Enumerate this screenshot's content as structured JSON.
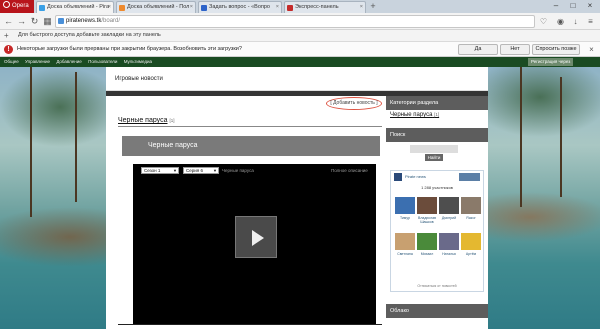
{
  "browser": {
    "menu_label": "Opera",
    "tabs": [
      {
        "title": "Доска объявлений - Pira",
        "color": "#3aa0e6",
        "active": true
      },
      {
        "title": "Доска объявлений - Пол",
        "color": "#ee8a2e",
        "active": false
      },
      {
        "title": "Задать вопрос - «Вопро",
        "color": "#2d63c9",
        "active": false
      },
      {
        "title": "Экспресс-панель",
        "color": "#c42b2b",
        "active": false
      }
    ],
    "url_host": "piratenews.tk",
    "url_path": "/board/",
    "bookmarks_hint": "Для быстрого доступа добавьте закладки на эту панель"
  },
  "notification": {
    "message": "Некоторые загрузки были прерваны при закрытии браузера. Возобновить эти загрузки?",
    "yes_label": "Да",
    "no_label": "Нет",
    "later_label": "Спросить позже"
  },
  "site_toolbar": {
    "links": [
      "Общее",
      "Управление",
      "Добавление",
      "Пользователи",
      "Мультимедиа"
    ],
    "register_label": "Регистрация через"
  },
  "page": {
    "section_title": "Игровые новости",
    "add_news_label": "[ Добавить новость ]",
    "category_link": "Черные паруса",
    "category_count": "[1]",
    "block_title": "Черные паруса",
    "player": {
      "season_select": "Сезон 1",
      "episode_select": "Серия 6",
      "video_title": "Черные паруса",
      "other_link": "Полное описание"
    }
  },
  "sidebar": {
    "categories_header": "Категории раздела",
    "category_link": "Черные паруса",
    "category_count": "[1]",
    "search_header": "Поиск",
    "search_button": "Найти",
    "vk": {
      "group_name": "Pirate news",
      "members": "1 288 участников",
      "people": [
        {
          "name": "Тимур",
          "color": "#3b6fb0"
        },
        {
          "name": "Владислав Шашков",
          "color": "#6b4c3b"
        },
        {
          "name": "Дмитрий",
          "color": "#4e4e4e"
        },
        {
          "name": "Razor",
          "color": "#8a7a6a"
        },
        {
          "name": "Светлана",
          "color": "#c8a070"
        },
        {
          "name": "Михаил",
          "color": "#4a8a3a"
        },
        {
          "name": "Наталья",
          "color": "#6a6a8a"
        },
        {
          "name": "Артём",
          "color": "#e4b830"
        }
      ],
      "footer": "Отписаться от новостей"
    },
    "cloud_header": "Облако"
  }
}
